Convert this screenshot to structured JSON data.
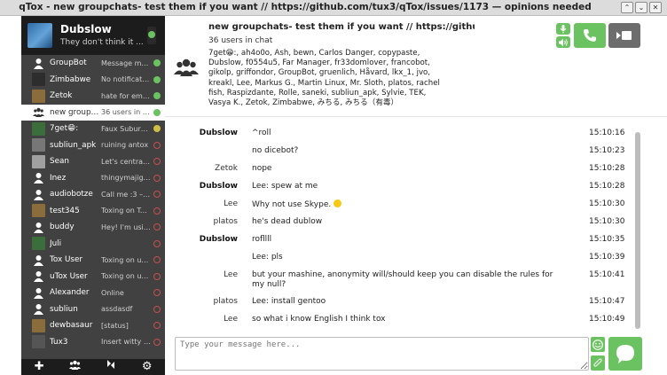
{
  "window": {
    "title": "qTox - new groupchats- test them if you want // https://github.com/tux3/qTox/issues/1173 — opinions needed",
    "controls": [
      "⌃",
      "⌄",
      "✕"
    ]
  },
  "profile": {
    "name": "Dubslow",
    "status": "They don't think it ..."
  },
  "contacts": [
    {
      "name": "GroupBot",
      "message": "Message me ...",
      "status": "online",
      "avatar": "person-icon"
    },
    {
      "name": "Zimbabwe",
      "message": "No notificatio...",
      "status": "online",
      "avatar": "custom-avatar"
    },
    {
      "name": "Zetok",
      "message": "hate for emai...",
      "status": "online",
      "avatar": "custom-avatar"
    },
    {
      "name": "new groupc...",
      "message": "36 users in c...",
      "status": "online",
      "avatar": "group-icon"
    },
    {
      "name": "7get😁:",
      "message": "Faux Suburbi...",
      "status": "away",
      "avatar": "custom-avatar"
    },
    {
      "name": "subliun_apk",
      "message": "ruining antox",
      "status": "busy",
      "avatar": "custom-avatar"
    },
    {
      "name": "Sean",
      "message": "Let's centrali...",
      "status": "busy",
      "avatar": "custom-avatar"
    },
    {
      "name": "Inez",
      "message": "thingymajigger",
      "status": "offline",
      "avatar": "person-icon"
    },
    {
      "name": "audiobotze",
      "message": "Call me :3 – i...",
      "status": "offline",
      "avatar": "person-icon"
    },
    {
      "name": "test345",
      "message": "Toxing on To...",
      "status": "offline",
      "avatar": "custom-avatar"
    },
    {
      "name": "buddy",
      "message": "Hey! I'm usin...",
      "status": "offline",
      "avatar": "person-icon"
    },
    {
      "name": "Juli",
      "message": "",
      "status": "offline",
      "avatar": "custom-avatar"
    },
    {
      "name": "Tox User",
      "message": "Toxing on uTox",
      "status": "offline",
      "avatar": "person-icon"
    },
    {
      "name": "uTox User",
      "message": "Toxing on uTox",
      "status": "offline",
      "avatar": "person-icon"
    },
    {
      "name": "Alexander",
      "message": "Online",
      "status": "offline",
      "avatar": "person-icon"
    },
    {
      "name": "subliun",
      "message": "assdasdf",
      "status": "offline",
      "avatar": "person-icon"
    },
    {
      "name": "dewbasaur",
      "message": "[status]",
      "status": "offline",
      "avatar": "custom-avatar"
    },
    {
      "name": "Tux3",
      "message": "Insert witty s...",
      "status": "offline",
      "avatar": "custom-avatar"
    }
  ],
  "sidebar_toolbar": [
    "add-friend-icon",
    "create-group-icon",
    "file-transfers-icon",
    "settings-icon"
  ],
  "chat": {
    "title": "new groupchats- test them if you want // https://githu...",
    "user_count": "36 users in chat",
    "members": "7get😁:, ah4o0o, Ash, bewn, Carlos Danger, copypaste, Dubslow, f0554u5, Far Manager, fr33domlover, francobot, gikolp, griffondor, GroupBot, gruenlich, Håvard, lkx_1, jvo, kreakl, Lee, Markus G., Martin Linux, Mr. Sloth, platos, rachel fish, Raspizdante, Rolle, saneki, subliun_apk, Sylvie, TEK, Vasya K., Zetok, Zimbabwe, みちる, みちる（有毒）"
  },
  "messages": [
    {
      "author": "Dubslow",
      "bold": true,
      "text": "^roll",
      "time": "15:10:16"
    },
    {
      "author": "",
      "bold": false,
      "text": "no dicebot?",
      "time": "15:10:23"
    },
    {
      "author": "Zetok",
      "bold": false,
      "text": "nope",
      "time": "15:10:28"
    },
    {
      "author": "Dubslow",
      "bold": true,
      "text": "Lee: spew at me",
      "time": "15:10:28"
    },
    {
      "author": "Lee",
      "bold": false,
      "text": "Why not use Skype.",
      "time": "15:10:30",
      "emoji": true
    },
    {
      "author": "platos",
      "bold": false,
      "text": "he's dead dublow",
      "time": "15:10:30"
    },
    {
      "author": "Dubslow",
      "bold": true,
      "text": "rofllll",
      "time": "15:10:35"
    },
    {
      "author": "",
      "bold": false,
      "text": "Lee: pls",
      "time": "15:10:39"
    },
    {
      "author": "Lee",
      "bold": false,
      "text": "but your mashine, anonymity will/should keep you can disable the rules for my null?",
      "time": "15:10:41"
    },
    {
      "author": "platos",
      "bold": false,
      "text": "Lee: install gentoo",
      "time": "15:10:47"
    },
    {
      "author": "Lee",
      "bold": false,
      "text": "so what i know English I think tox",
      "time": "15:10:49"
    }
  ],
  "input": {
    "placeholder": "Type your message here...",
    "value": ""
  },
  "colors": {
    "accent_green": "#6bc260",
    "sidebar_bg": "#414141",
    "sidebar_dark": "#1c1c1c",
    "busy_red": "#c84e4e",
    "away_yellow": "#cebf44"
  }
}
